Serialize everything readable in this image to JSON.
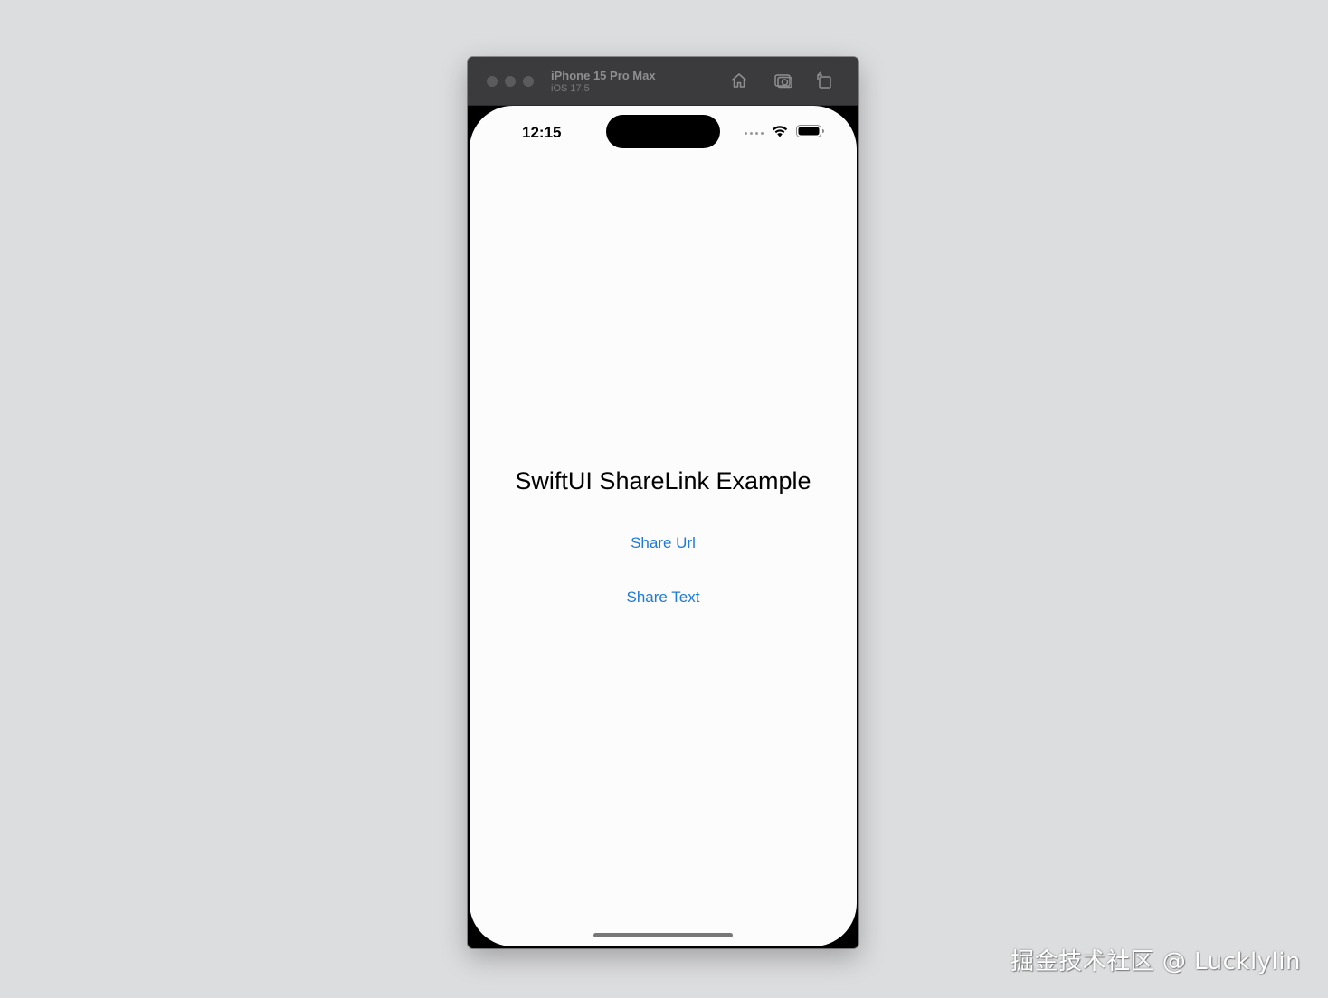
{
  "simulator": {
    "device_name": "iPhone 15 Pro Max",
    "os_version": "iOS 17.5",
    "toolbar_icons": [
      "home-icon",
      "screenshot-icon",
      "rotate-icon"
    ]
  },
  "status_bar": {
    "time": "12:15",
    "icons": [
      "cellular-signal-icon",
      "wifi-icon",
      "battery-icon"
    ]
  },
  "app": {
    "title": "SwiftUI ShareLink Example",
    "buttons": [
      {
        "label": "Share Url"
      },
      {
        "label": "Share Text"
      }
    ],
    "accent_color": "#1f7ad8"
  },
  "watermark": {
    "text": "掘金技术社区 @ Lucklylin"
  }
}
